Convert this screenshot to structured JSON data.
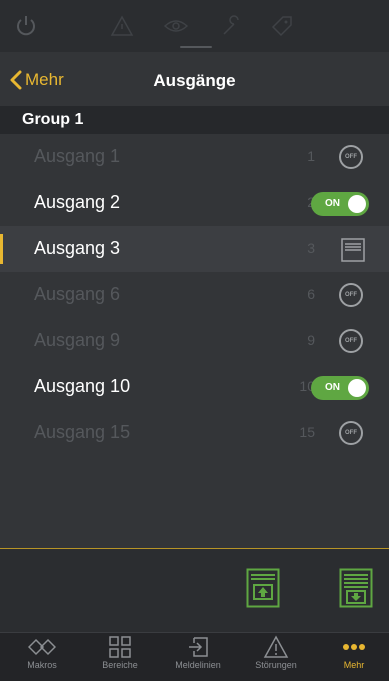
{
  "statusbar": {
    "icons": [
      "power-icon",
      "warning-icon",
      "eye-icon",
      "wrench-icon",
      "tag-icon"
    ]
  },
  "navbar": {
    "back_label": "Mehr",
    "title": "Ausgänge"
  },
  "group": {
    "title": "Group 1"
  },
  "outputs": [
    {
      "name": "Ausgang 1",
      "number": "1",
      "state": "off",
      "control": "OFF"
    },
    {
      "name": "Ausgang 2",
      "number": "2",
      "state": "on",
      "control": "ON"
    },
    {
      "name": "Ausgang 3",
      "number": "3",
      "state": "shutter",
      "control": ""
    },
    {
      "name": "Ausgang 6",
      "number": "6",
      "state": "off",
      "control": "OFF"
    },
    {
      "name": "Ausgang 9",
      "number": "9",
      "state": "off",
      "control": "OFF"
    },
    {
      "name": "Ausgang 10",
      "number": "10",
      "state": "on",
      "control": "ON"
    },
    {
      "name": "Ausgang 15",
      "number": "15",
      "state": "off",
      "control": "OFF"
    }
  ],
  "actions": {
    "up_icon": "shutter-up-icon",
    "down_icon": "shutter-down-icon"
  },
  "tabs": [
    {
      "label": "Makros",
      "icon": "macros-icon"
    },
    {
      "label": "Bereiche",
      "icon": "areas-icon"
    },
    {
      "label": "Meldelinien",
      "icon": "zones-icon"
    },
    {
      "label": "Störungen",
      "icon": "faults-icon"
    },
    {
      "label": "Mehr",
      "icon": "more-icon"
    }
  ],
  "colors": {
    "accent": "#e8b731",
    "on_green": "#5fa742",
    "action_green": "#5fa742",
    "background": "#333538"
  }
}
